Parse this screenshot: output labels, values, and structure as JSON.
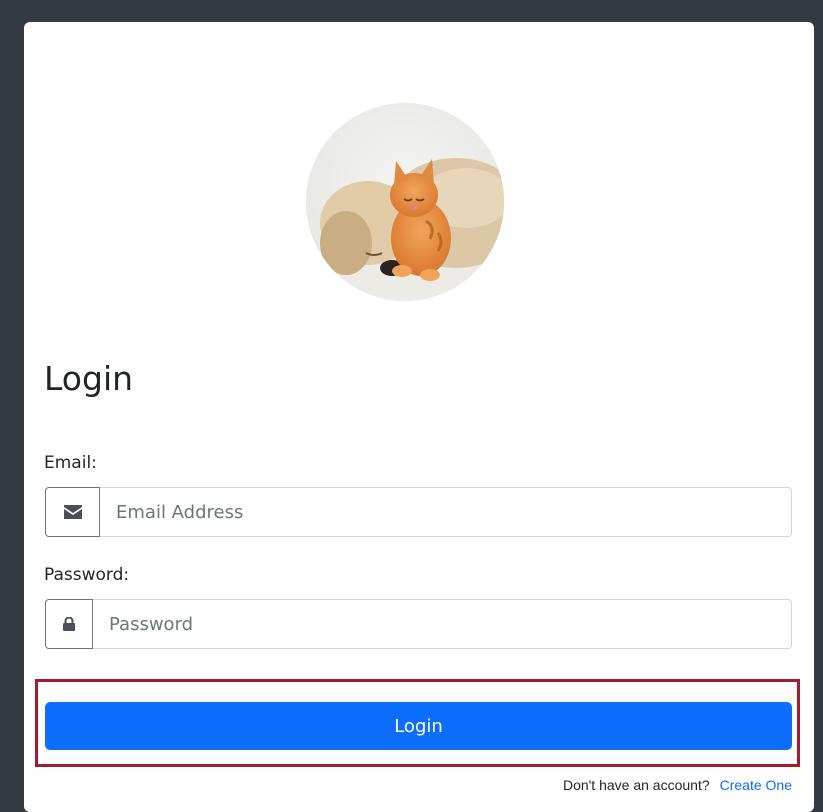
{
  "login_form": {
    "title": "Login",
    "avatar_description_icon": "puppy-and-kitten-photo",
    "email": {
      "label": "Email:",
      "placeholder": "Email Address",
      "icon": "envelope-icon"
    },
    "password": {
      "label": "Password:",
      "placeholder": "Password",
      "icon": "lock-icon"
    },
    "submit_label": "Login",
    "footer": {
      "prompt": "Don't have an account?",
      "link_text": "Create One"
    }
  },
  "colors": {
    "page_background": "#343a40",
    "card_background": "#ffffff",
    "primary_button": "#0d6efd",
    "highlight_border": "#a51c30",
    "link": "#0d6efd"
  }
}
